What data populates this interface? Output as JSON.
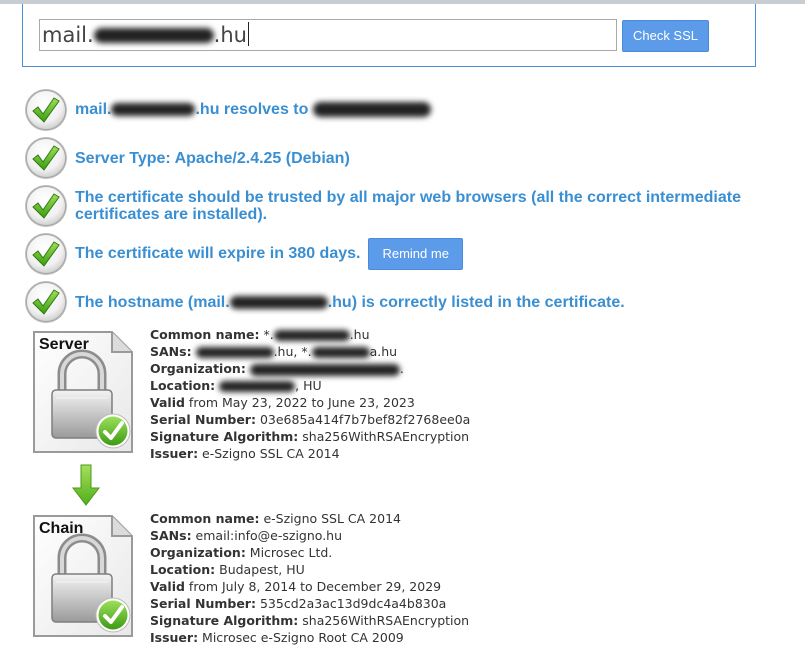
{
  "search": {
    "value_prefix": "mail.",
    "value_suffix": ".hu",
    "button_label": "Check SSL"
  },
  "results": {
    "resolves": {
      "prefix": "mail.",
      "suffix": ".hu resolves to"
    },
    "server_type": "Server Type: Apache/2.4.25 (Debian)",
    "trusted": "The certificate should be trusted by all major web browsers (all the correct intermediate certificates are installed).",
    "expire": "The certificate will expire in 380 days.",
    "remind_label": "Remind me",
    "hostname": {
      "prefix": "The hostname (mail.",
      "suffix": ".hu) is correctly listed in the certificate."
    }
  },
  "server_cert": {
    "badge": "Server",
    "common_name_label": "Common name:",
    "common_name_prefix": " *.",
    "common_name_suffix": ".hu",
    "sans_label": "SANs:",
    "sans_part1_suffix": ".hu, *.",
    "sans_part2_suffix": "a.hu",
    "org_label": "Organization:",
    "org_suffix": ".",
    "location_label": "Location:",
    "location_suffix": ", HU",
    "valid_label": "Valid",
    "valid_text": " from May 23, 2022 to June 23, 2023",
    "serial_label": "Serial Number:",
    "serial": " 03e685a414f7b7bef82f2768ee0a",
    "sigalg_label": "Signature Algorithm:",
    "sigalg": " sha256WithRSAEncryption",
    "issuer_label": "Issuer:",
    "issuer": " e-Szigno SSL CA 2014"
  },
  "chain_cert": {
    "badge": "Chain",
    "common_name_label": "Common name:",
    "common_name": " e-Szigno SSL CA 2014",
    "sans_label": "SANs:",
    "sans": " email:info@e-szigno.hu",
    "org_label": "Organization:",
    "org": " Microsec Ltd.",
    "location_label": "Location:",
    "location": " Budapest, HU",
    "valid_label": "Valid",
    "valid_text": " from July 8, 2014 to December 29, 2029",
    "serial_label": "Serial Number:",
    "serial": " 535cd2a3ac13d9dc4a4b830a",
    "sigalg_label": "Signature Algorithm:",
    "sigalg": " sha256WithRSAEncryption",
    "issuer_label": "Issuer:",
    "issuer": " Microsec e-Szigno Root CA 2009"
  },
  "colors": {
    "accent": "#3a8fd2",
    "button": "#5b9bea",
    "check_green": "#58b62c"
  },
  "icons": {
    "check": "green-check-icon",
    "lock": "padlock-certificate-icon",
    "arrow": "down-arrow-icon"
  }
}
